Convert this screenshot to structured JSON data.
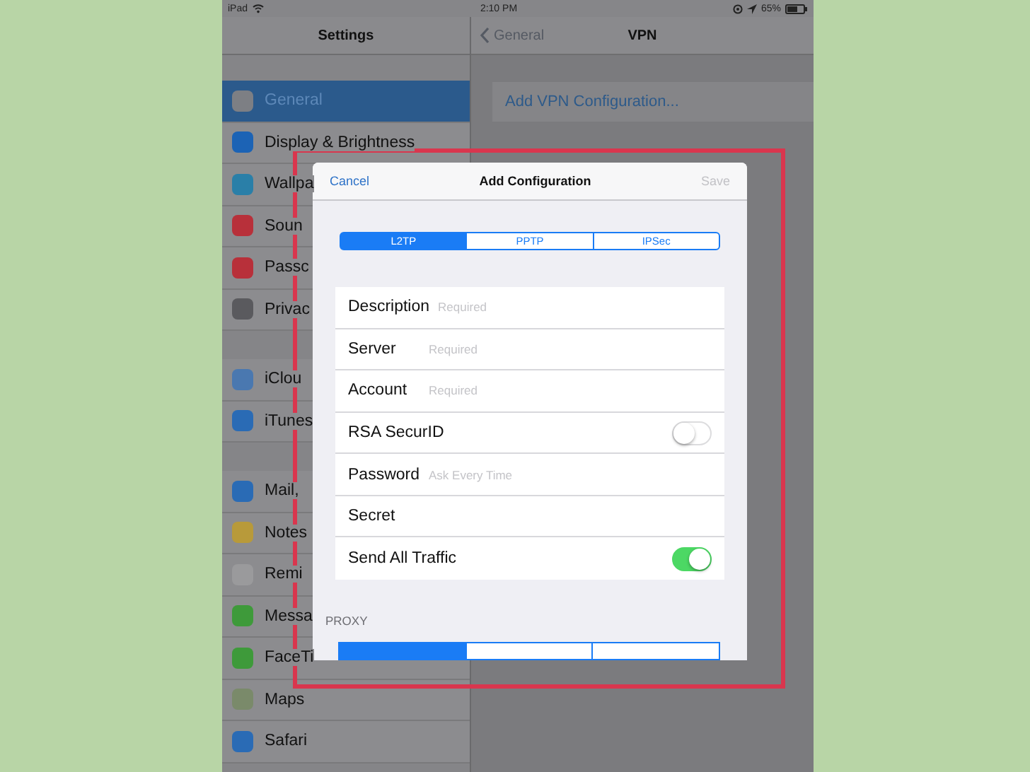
{
  "status_bar": {
    "device": "iPad",
    "time": "2:10 PM",
    "battery": "65%"
  },
  "sidebar": {
    "title": "Settings",
    "groups": [
      [
        {
          "label": "General",
          "selected": true,
          "color": "#7d7f84"
        },
        {
          "label": "Display & Brightness",
          "selected": false,
          "color": "#1c63b5"
        },
        {
          "label": "Wallpa",
          "selected": false,
          "color": "#2a7fa8"
        },
        {
          "label": "Soun",
          "selected": false,
          "color": "#b8303a"
        },
        {
          "label": "Passc",
          "selected": false,
          "color": "#b8303a"
        },
        {
          "label": "Privac",
          "selected": false,
          "color": "#5a5a5e"
        }
      ],
      [
        {
          "label": "iClou",
          "selected": false,
          "color": "#4a78b0"
        },
        {
          "label": "iTunes",
          "selected": false,
          "color": "#2a6bb5"
        }
      ],
      [
        {
          "label": "Mail,",
          "selected": false,
          "color": "#2a6bb5"
        },
        {
          "label": "Notes",
          "selected": false,
          "color": "#b89a3a"
        },
        {
          "label": "Remi",
          "selected": false,
          "color": "#9a9a9c"
        },
        {
          "label": "Messa",
          "selected": false,
          "color": "#3e9a3a"
        },
        {
          "label": "FaceTi",
          "selected": false,
          "color": "#3e9a3a"
        },
        {
          "label": "Maps",
          "selected": false,
          "color": "#7a8a6a"
        },
        {
          "label": "Safari",
          "selected": false,
          "color": "#2a6bb5"
        }
      ]
    ]
  },
  "detail": {
    "back": "General",
    "title": "VPN",
    "add_button": "Add VPN Configuration..."
  },
  "dialog": {
    "cancel": "Cancel",
    "title": "Add Configuration",
    "save": {
      "label": "Save",
      "disabled": true
    },
    "types": [
      {
        "label": "L2TP",
        "selected": true
      },
      {
        "label": "PPTP",
        "selected": false
      },
      {
        "label": "IPSec",
        "selected": false
      }
    ],
    "fields": [
      {
        "kind": "text",
        "label": "Description",
        "placeholder": "Required"
      },
      {
        "kind": "text",
        "label": "Server",
        "placeholder": "Required"
      },
      {
        "kind": "text",
        "label": "Account",
        "placeholder": "Required"
      },
      {
        "kind": "toggle",
        "label": "RSA SecurID",
        "on": false
      },
      {
        "kind": "text",
        "label": "Password",
        "placeholder": "Ask Every Time"
      },
      {
        "kind": "text",
        "label": "Secret"
      },
      {
        "kind": "toggle",
        "label": "Send All Traffic",
        "on": true
      }
    ],
    "proxy_title": "PROXY",
    "proxy_modes": [
      {
        "selected": true
      },
      {
        "selected": false
      },
      {
        "selected": false
      }
    ]
  }
}
